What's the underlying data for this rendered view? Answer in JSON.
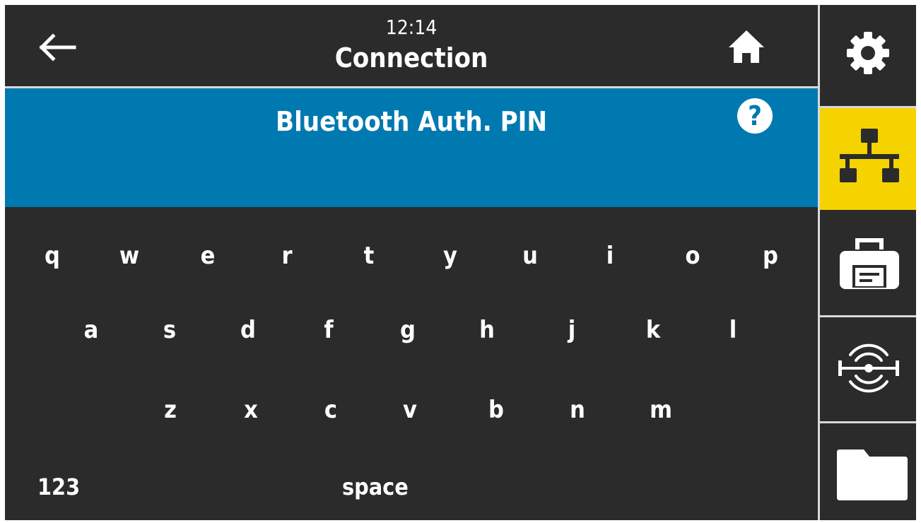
{
  "header": {
    "time": "12:14",
    "title": "Connection"
  },
  "banner": {
    "title": "Bluetooth Auth. PIN",
    "help_label": "?"
  },
  "keyboard": {
    "row1": [
      "q",
      "w",
      "e",
      "r",
      "t",
      "y",
      "u",
      "i",
      "o",
      "p"
    ],
    "row2": [
      "a",
      "s",
      "d",
      "f",
      "g",
      "h",
      "j",
      "k",
      "l"
    ],
    "row3": [
      "z",
      "x",
      "c",
      "v",
      "b",
      "n",
      "m"
    ],
    "mode_label": "123",
    "space_label": "space"
  },
  "sidebar": {
    "items": [
      {
        "icon": "gear-icon",
        "active": false
      },
      {
        "icon": "network-icon",
        "active": true
      },
      {
        "icon": "printer-icon",
        "active": false
      },
      {
        "icon": "sensor-icon",
        "active": false
      },
      {
        "icon": "folder-icon",
        "active": false
      }
    ]
  },
  "colors": {
    "background": "#2b2b2b",
    "banner": "#0079b1",
    "active_tab": "#f5d300",
    "text": "#ffffff"
  }
}
